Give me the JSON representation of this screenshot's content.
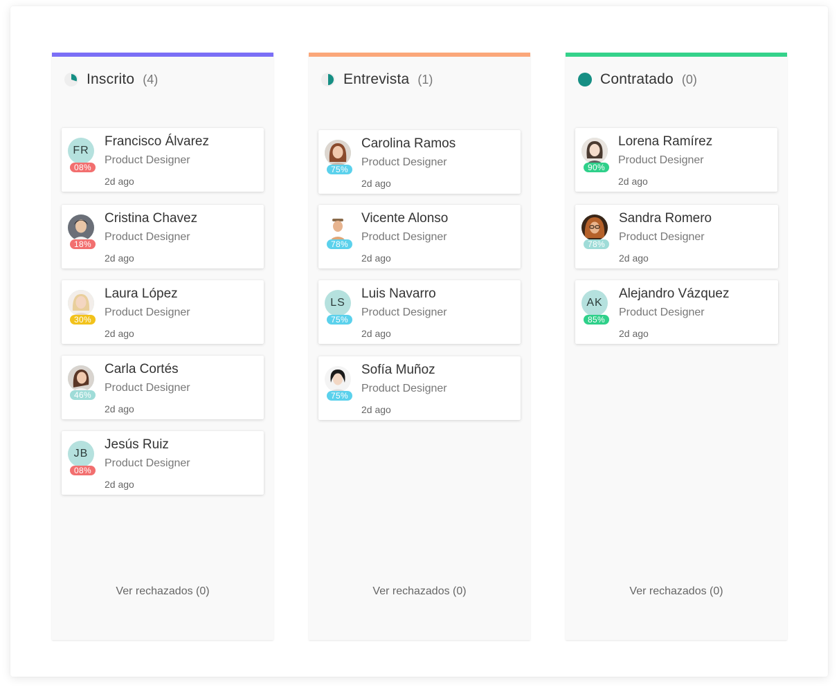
{
  "columns": [
    {
      "title": "Inscrito",
      "count": "(4)",
      "accent": "#7b6ff6",
      "icon": "progress-quarter-icon",
      "footer": "Ver rechazados (0)",
      "cards": [
        {
          "name": "Francisco Álvarez",
          "role": "Product Designer",
          "time": "2d ago",
          "score": "08%",
          "score_color": "#f26f6f",
          "initials": "FR",
          "avatar": "initials"
        },
        {
          "name": "Cristina Chavez",
          "role": "Product Designer",
          "time": "2d ago",
          "score": "18%",
          "score_color": "#f26f6f",
          "initials": "",
          "avatar": "photo"
        },
        {
          "name": "Laura López",
          "role": "Product Designer",
          "time": "2d ago",
          "score": "30%",
          "score_color": "#f2c21b",
          "initials": "",
          "avatar": "photo"
        },
        {
          "name": "Carla Cortés",
          "role": "Product Designer",
          "time": "2d ago",
          "score": "46%",
          "score_color": "#9fdcd8",
          "initials": "",
          "avatar": "photo"
        },
        {
          "name": "Jesús Ruiz",
          "role": "Product Designer",
          "time": "2d ago",
          "score": "08%",
          "score_color": "#f26f6f",
          "initials": "JB",
          "avatar": "initials"
        }
      ]
    },
    {
      "title": "Entrevista",
      "count": "(1)",
      "accent": "#fba77a",
      "icon": "progress-half-icon",
      "footer": "Ver rechazados (0)",
      "cards": [
        {
          "name": "Carolina Ramos",
          "role": "Product Designer",
          "time": "2d ago",
          "score": "75%",
          "score_color": "#5bd1ec",
          "initials": "",
          "avatar": "photo"
        },
        {
          "name": "Vicente Alonso",
          "role": "Product Designer",
          "time": "2d ago",
          "score": "78%",
          "score_color": "#5bd1ec",
          "initials": "",
          "avatar": "photo"
        },
        {
          "name": "Luis Navarro",
          "role": "Product Designer",
          "time": "2d ago",
          "score": "75%",
          "score_color": "#5bd1ec",
          "initials": "LS",
          "avatar": "initials"
        },
        {
          "name": "Sofía Muñoz",
          "role": "Product Designer",
          "time": "2d ago",
          "score": "75%",
          "score_color": "#5bd1ec",
          "initials": "",
          "avatar": "photo"
        }
      ]
    },
    {
      "title": "Contratado",
      "count": "(0)",
      "accent": "#35d28b",
      "icon": "progress-full-icon",
      "footer": "Ver rechazados (0)",
      "cards": [
        {
          "name": "Lorena Ramírez",
          "role": "Product Designer",
          "time": "2d ago",
          "score": "90%",
          "score_color": "#2fd08a",
          "initials": "",
          "avatar": "photo"
        },
        {
          "name": "Sandra Romero",
          "role": "Product Designer",
          "time": "2d ago",
          "score": "78%",
          "score_color": "#9fdcd8",
          "initials": "",
          "avatar": "photo"
        },
        {
          "name": "Alejandro Vázquez",
          "role": "Product Designer",
          "time": "2d ago",
          "score": "85%",
          "score_color": "#2fd08a",
          "initials": "AK",
          "avatar": "initials"
        }
      ]
    }
  ]
}
